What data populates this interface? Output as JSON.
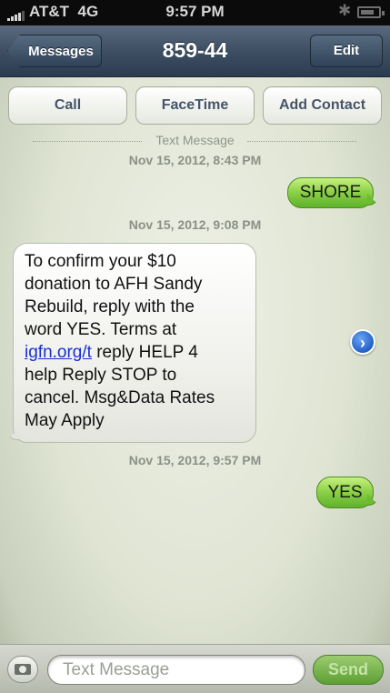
{
  "status_bar": {
    "carrier": "AT&T",
    "network": "4G",
    "time": "9:57 PM"
  },
  "nav": {
    "back_label": "Messages",
    "title": "859-44",
    "edit_label": "Edit"
  },
  "actions": {
    "call": "Call",
    "facetime": "FaceTime",
    "add_contact": "Add Contact"
  },
  "thread": {
    "separator": "Text Message",
    "timestamps": [
      "Nov 15, 2012, 8:43 PM",
      "Nov 15, 2012, 9:08 PM",
      "Nov 15, 2012, 9:57 PM"
    ],
    "sent_1": "SHORE",
    "received_1": {
      "lines": [
        "To confirm your $10",
        "donation to AFH Sandy",
        "Rebuild, reply with the",
        "word YES. Terms at"
      ],
      "link": "igfn.org/t",
      "after_link": " reply HELP 4",
      "lines_2": [
        "help Reply STOP to",
        "cancel. Msg&Data Rates",
        "May Apply"
      ]
    },
    "sent_2": "YES"
  },
  "composer": {
    "placeholder": "Text Message",
    "send_label": "Send"
  },
  "icons": [
    "signal-bars-icon",
    "bluetooth-icon",
    "battery-icon",
    "detail-disclosure-icon",
    "camera-icon"
  ]
}
